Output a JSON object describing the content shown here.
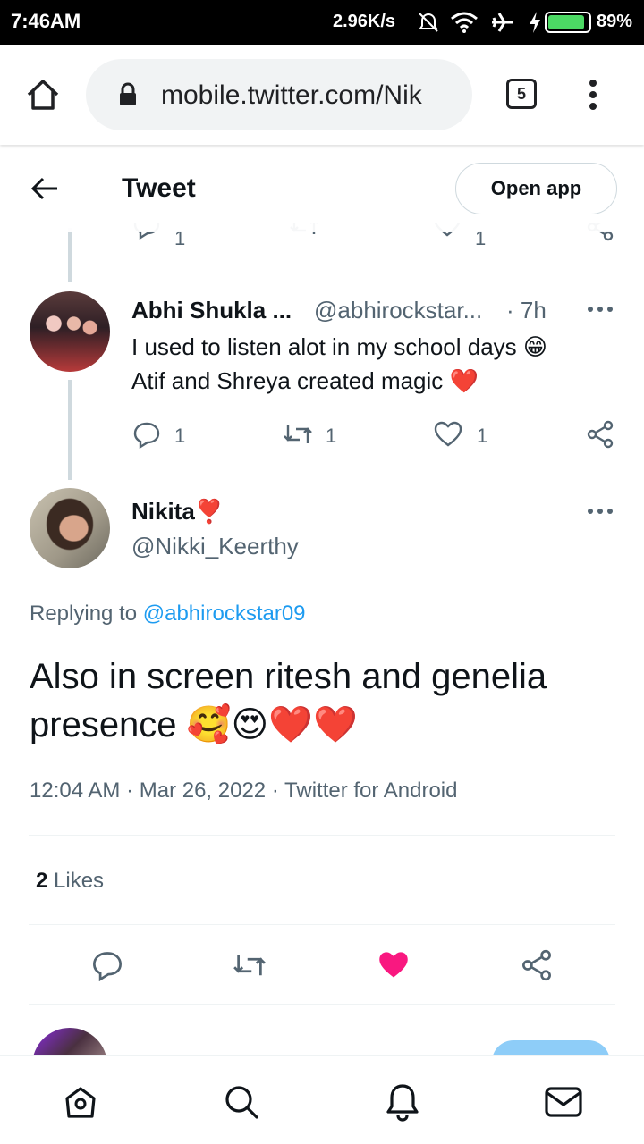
{
  "status_bar": {
    "time": "7:46AM",
    "speed": "2.96K/s",
    "battery_pct": "89%"
  },
  "browser": {
    "url": "mobile.twitter.com/Nik",
    "tab_count": "5"
  },
  "header": {
    "title": "Tweet",
    "open_app": "Open app"
  },
  "prev_tweet_actions": {
    "reply_count": "1",
    "like_count": "1"
  },
  "reply_tweet": {
    "name": "Abhi Shukla ...",
    "handle": "@abhirockstar...",
    "time": "· 7h",
    "line1": "I used to listen alot in my school days 😁",
    "line2": "Atif and Shreya created magic ❤️",
    "reply_count": "1",
    "retweet_count": "1",
    "like_count": "1"
  },
  "main_tweet": {
    "name": "Nikita❣️",
    "handle": "@Nikki_Keerthy",
    "replying_prefix": "Replying to ",
    "replying_handle": "@abhirockstar09",
    "text_line1": "Also in screen ritesh and genelia",
    "text_line2": "presence 🥰😍❤️❤️",
    "timestamp": "12:04 AM · Mar 26, 2022 · Twitter for Android",
    "likes_count": "2",
    "likes_label": "Likes"
  },
  "colors": {
    "accent": "#1d9bf0",
    "like_pink": "#f91880",
    "text_primary": "#0f1419",
    "text_secondary": "#536471"
  },
  "icons": [
    "home-icon",
    "lock-icon",
    "more-vert-icon",
    "back-arrow-icon",
    "reply-icon",
    "retweet-icon",
    "like-icon",
    "share-icon",
    "search-icon",
    "notifications-icon",
    "messages-icon"
  ]
}
